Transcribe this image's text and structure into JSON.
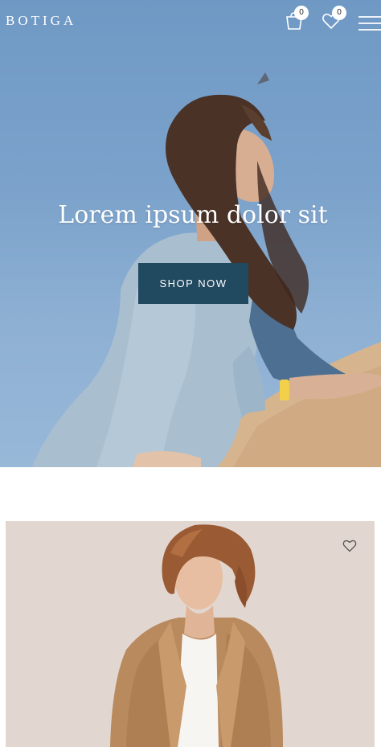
{
  "header": {
    "logo": "BOTIGA",
    "cart_count": "0",
    "wishlist_count": "0",
    "icons": [
      "shopping-bag-icon",
      "heart-icon",
      "hamburger-menu-icon"
    ]
  },
  "hero": {
    "title": "Lorem ipsum dolor sit",
    "cta_label": "SHOP NOW"
  },
  "product": {
    "wishlist_icon": "heart-outline-icon"
  },
  "colors": {
    "button_bg": "#21495f",
    "sky": "#7ba2cb",
    "white": "#ffffff"
  }
}
